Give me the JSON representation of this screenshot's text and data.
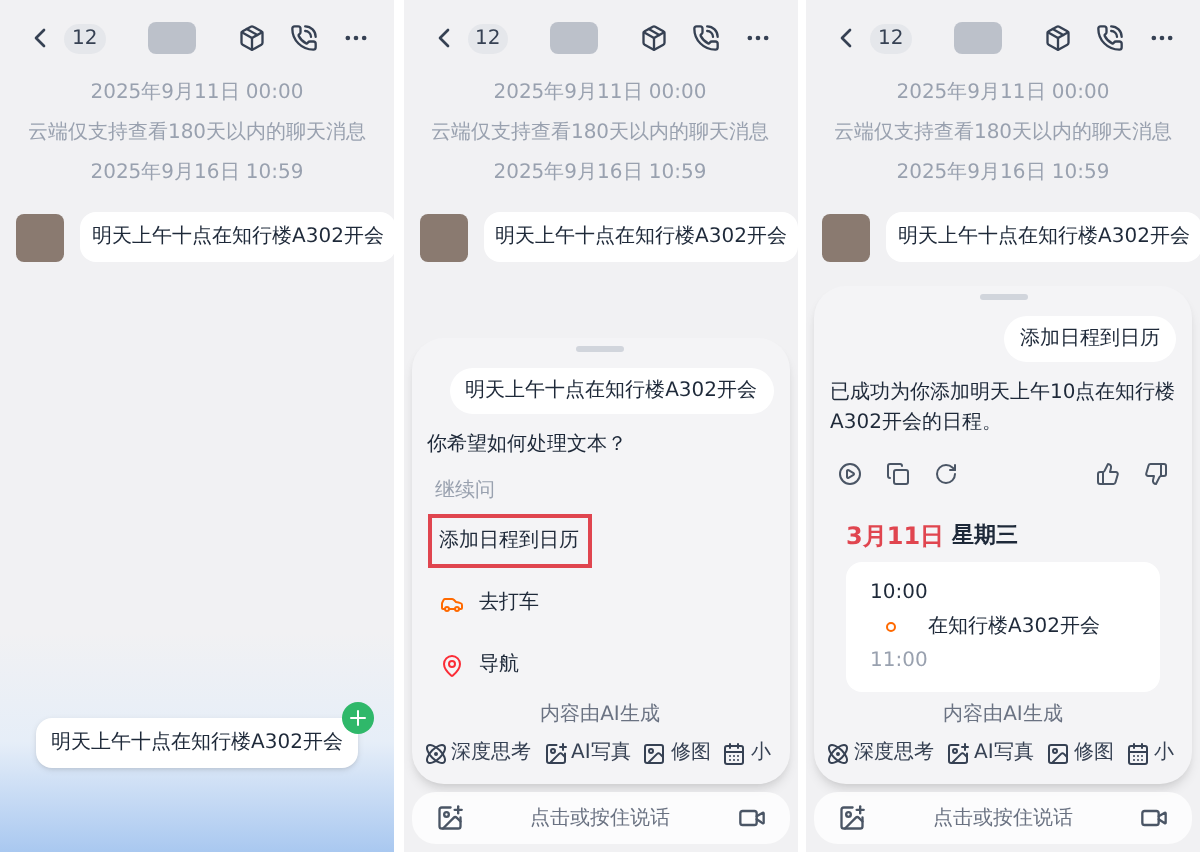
{
  "panels": [
    {
      "kind": "floating",
      "header": {
        "back_count": "12"
      },
      "chat": {
        "timestamps": [
          "2025年9月11日 00:00",
          "云端仅支持查看180天以内的聊天消息",
          "2025年9月16日 10:59"
        ],
        "message": "明天上午十点在知行楼A302开会"
      },
      "floating_bubble": {
        "text": "明天上午十点在知行楼A302开会"
      }
    },
    {
      "kind": "options",
      "header": {
        "back_count": "12"
      },
      "chat": {
        "timestamps": [
          "2025年9月11日 00:00",
          "云端仅支持查看180天以内的聊天消息",
          "2025年9月16日 10:59"
        ],
        "message": "明天上午十点在知行楼A302开会"
      },
      "sheet": {
        "user_bubble": "明天上午十点在知行楼A302开会",
        "question": "你希望如何处理文本？",
        "section_label": "继续问",
        "options": [
          {
            "label": "添加日程到日历",
            "kind": "plain",
            "selected": true
          },
          {
            "label": "去打车",
            "kind": "car",
            "selected": false
          },
          {
            "label": "导航",
            "kind": "pin",
            "selected": false
          }
        ],
        "ai_note": "内容由AI生成",
        "tools": [
          "深度思考",
          "AI写真",
          "修图",
          "小"
        ],
        "input_hint": "点击或按住说话"
      }
    },
    {
      "kind": "calendar",
      "header": {
        "back_count": "12"
      },
      "chat": {
        "timestamps": [
          "2025年9月11日 00:00",
          "云端仅支持查看180天以内的聊天消息",
          "2025年9月16日 10:59"
        ],
        "message": "明天上午十点在知行楼A302开会"
      },
      "sheet": {
        "user_bubble": "添加日程到日历",
        "reply": "已成功为你添加明天上午10点在知行楼A302开会的日程。",
        "calendar": {
          "date": "3月11日",
          "weekday": "星期三",
          "start": "10:00",
          "event": "在知行楼A302开会",
          "end": "11:00"
        },
        "ai_note": "内容由AI生成",
        "tools": [
          "深度思考",
          "AI写真",
          "修图",
          "小"
        ],
        "input_hint": "点击或按住说话"
      }
    }
  ]
}
